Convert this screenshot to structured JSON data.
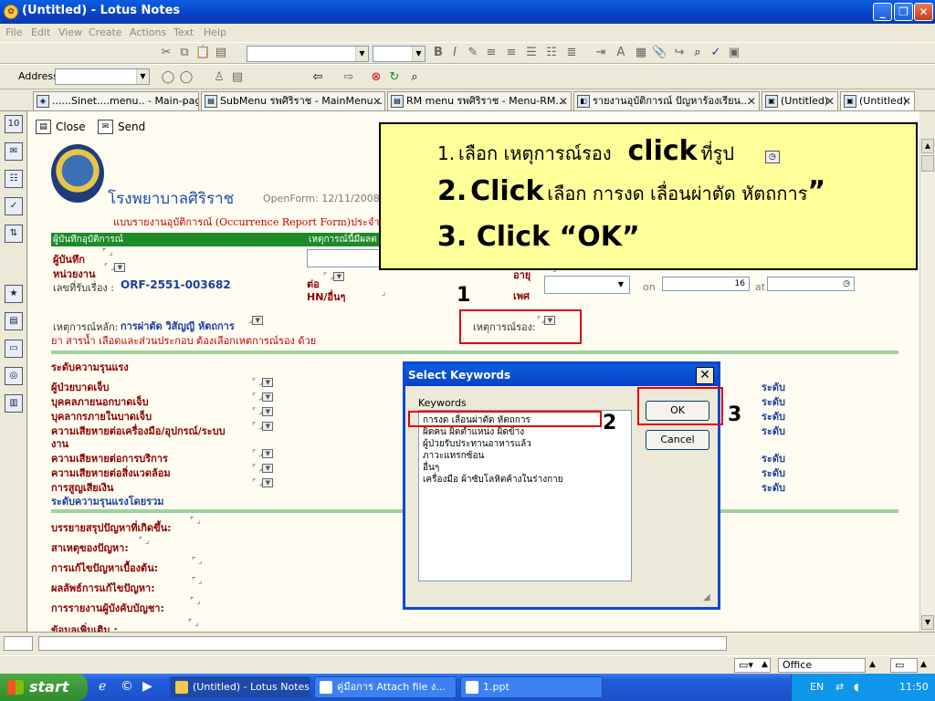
{
  "window": {
    "title": "(Untitled) - Lotus Notes",
    "app_icon": "lotus-notes-icon"
  },
  "menu": [
    "File",
    "Edit",
    "View",
    "Create",
    "Actions",
    "Text",
    "Help"
  ],
  "address": {
    "label": "Address",
    "value": ""
  },
  "tabs": [
    {
      "label": "......Sinet....menu.. - Main-page..."
    },
    {
      "label": "SubMenu รพศิริราช - MainMenu..."
    },
    {
      "label": "RM menu รพศิริราช - Menu-RM..."
    },
    {
      "label": "รายงานอุบัติการณ์ ปัญหาร้องเรียน..."
    },
    {
      "label": "(Untitled)"
    },
    {
      "label": "(Untitled)"
    }
  ],
  "actions": {
    "close": "Close",
    "send": "Send"
  },
  "form": {
    "hospital_name": "โรงพยาบาลศิริราช",
    "openform": "OpenForm: 12/11/2008",
    "form_title": "แบบรายงานอุบัติการณ์ (Occurrence Report Form)ประจำ",
    "green_header": "ผู้บันทึกอุบัติการณ์",
    "green_header2": "เหตุการณ์นี้มีผลต",
    "recorder_label": "ผู้บันทึก",
    "unit_label": "หน่วยงาน",
    "refno_label": "เลขที่รับเรื่อง :",
    "refno_value": "ORF-2551-003682",
    "ext_label": "ต่อ",
    "hn_label": "HN/อื่นๆ",
    "age_label": "อายุ",
    "sex_label": "เพศ",
    "on_label": "on",
    "on_value": "16",
    "at_label": "at",
    "main_event_label": "เหตุการณ์หลัก:",
    "main_event_value": "การผ่าตัด วิสัญญี หัตถการ",
    "sub_event_label": "เหตุการณ์รอง:",
    "note": "ยา สารน้ำ เลือดและส่วนประกอบ ต้องเลือกเหตการณ์รอง ด้วย",
    "severity_header": "ระดับความรุนแรง",
    "severity_rows": [
      "ผู้ป่วยบาดเจ็บ",
      "บุคคลภายนอกบาดเจ็บ",
      "บุคลากรภายในบาดเจ็บ",
      "ความเสียหายต่อเครื่องมือ/อุปกรณ์/ระบบ",
      "งาน",
      "ความเสียหายต่อการบริการ",
      "ความเสียหายต่อสิ่งแวดล้อม",
      "การสูญเสียเงิน"
    ],
    "level_word": "ระดับ",
    "overall_label": "ระดับความรุนแรงโดยรวม",
    "text_fields": [
      "บรรยายสรุปปัญหาที่เกิดขึ้น:",
      "สาเหตุของปัญหา:",
      "การแก้ไขปัญหาเบื้องต้น:",
      "ผลลัพธ์การแก้ไขปัญหา:",
      "การรายงานผู้บังคับบัญชา:",
      "ข้อมูลเพิ่มเติม :"
    ]
  },
  "callout": {
    "line1_num": "1.",
    "line1_a": "เลือก   เหตุการณ์รอง",
    "line1_click": "click",
    "line1_b": "ที่รูป",
    "line2_num": "2.",
    "line2_click": "Click",
    "line2_b": "เลือก  การงด เลื่อนผ่าตัด หัตถการ",
    "line2_quote": "”",
    "line3": "3. Click “OK”"
  },
  "markers": {
    "m1": "1",
    "m2": "2",
    "m3": "3"
  },
  "dialog": {
    "title": "Select Keywords",
    "list_label": "Keywords",
    "keywords": [
      "การงด เลื่อนผ่าตัด หัตถการ",
      "ผิดคน ผิดตำแหน่ง ผิดข้าง",
      "ผู้ป่วยรับประทานอาหารแล้ว",
      "ภาวะแทรกซ้อน",
      "อื่นๆ",
      "เครื่องมือ ผ้าซับโลหิตค้างในร่างกาย"
    ],
    "ok_label": "OK",
    "cancel_label": "Cancel"
  },
  "statusbar": {
    "location": "Office"
  },
  "taskbar": {
    "start": "start",
    "tasks": [
      {
        "label": "(Untitled) - Lotus Notes"
      },
      {
        "label": "คู่มือการ Attach file ง..."
      },
      {
        "label": "1.ppt"
      }
    ],
    "lang": "EN",
    "clock": "11:50"
  }
}
